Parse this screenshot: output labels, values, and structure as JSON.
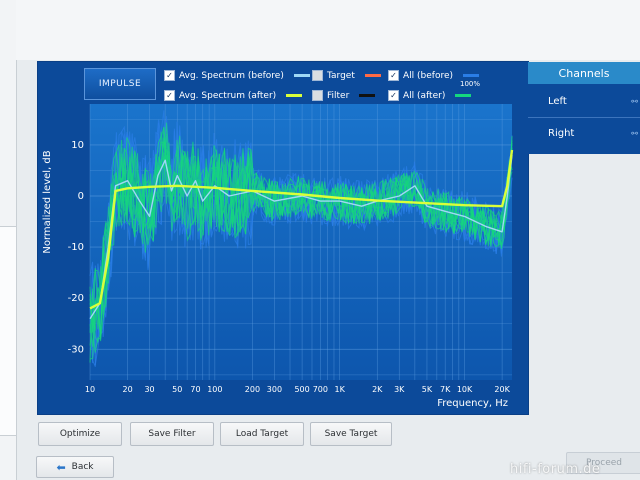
{
  "impulse_button": {
    "label": "IMPULSE"
  },
  "legend": {
    "avg_before": {
      "label": "Avg. Spectrum (before)",
      "checked": true,
      "color": "#9fd8f5"
    },
    "avg_after": {
      "label": "Avg. Spectrum (after)",
      "checked": true,
      "color": "#d9ff3a"
    },
    "target": {
      "label": "Target",
      "checked": false,
      "color": "#ff6a45"
    },
    "filter": {
      "label": "Filter",
      "checked": false,
      "color": "#111111"
    },
    "all_before": {
      "label": "All (before)",
      "checked": true,
      "color": "#2a7de6"
    },
    "all_after": {
      "label": "All (after)",
      "checked": true,
      "color": "#15d77e"
    },
    "percent": "100%"
  },
  "channels": {
    "header": "Channels",
    "items": [
      {
        "label": "Left"
      },
      {
        "label": "Right"
      }
    ]
  },
  "buttons": {
    "optimize": "Optimize",
    "save_filter": "Save Filter",
    "load_target": "Load Target",
    "save_target": "Save Target",
    "back": "Back",
    "proceed": "Proceed"
  },
  "watermark": "hifi-forum.de",
  "chart_data": {
    "type": "line",
    "xlabel": "Frequency, Hz",
    "ylabel": "Normalized level, dB",
    "x_scale": "log",
    "xlim": [
      10,
      24000
    ],
    "ylim": [
      -36,
      18
    ],
    "x_ticks": [
      {
        "v": 10,
        "label": "10"
      },
      {
        "v": 20,
        "label": "20"
      },
      {
        "v": 30,
        "label": "30"
      },
      {
        "v": 50,
        "label": "50"
      },
      {
        "v": 70,
        "label": "70"
      },
      {
        "v": 100,
        "label": "100"
      },
      {
        "v": 200,
        "label": "200"
      },
      {
        "v": 300,
        "label": "300"
      },
      {
        "v": 500,
        "label": "500"
      },
      {
        "v": 700,
        "label": "700"
      },
      {
        "v": 1000,
        "label": "1K"
      },
      {
        "v": 2000,
        "label": "2K"
      },
      {
        "v": 3000,
        "label": "3K"
      },
      {
        "v": 5000,
        "label": "5K"
      },
      {
        "v": 7000,
        "label": "7K"
      },
      {
        "v": 10000,
        "label": "10K"
      },
      {
        "v": 20000,
        "label": "20K"
      }
    ],
    "y_ticks": [
      {
        "v": 10,
        "label": "10"
      },
      {
        "v": 0,
        "label": "0"
      },
      {
        "v": -10,
        "label": "-10"
      },
      {
        "v": -20,
        "label": "-20"
      },
      {
        "v": -30,
        "label": "-30"
      }
    ],
    "grid": true,
    "series": [
      {
        "name": "Avg. Spectrum (after)",
        "color": "#d9ff3a",
        "x": [
          10,
          12,
          14,
          16,
          20,
          30,
          50,
          100,
          200,
          500,
          1000,
          2000,
          5000,
          10000,
          20000,
          22000,
          24000
        ],
        "y": [
          -22,
          -21,
          -12,
          1,
          1.5,
          1.8,
          2,
          1.6,
          1,
          0.3,
          -0.4,
          -0.9,
          -1.4,
          -1.8,
          -2,
          2,
          9
        ]
      },
      {
        "name": "Avg. Spectrum (before)",
        "color": "#9fd8f5",
        "x": [
          10,
          12,
          14,
          16,
          20,
          25,
          30,
          35,
          40,
          45,
          50,
          60,
          70,
          80,
          100,
          130,
          200,
          300,
          500,
          700,
          1000,
          1500,
          2000,
          3000,
          4000,
          5000,
          7000,
          10000,
          15000,
          20000,
          22000,
          24000
        ],
        "y": [
          -24,
          -21,
          -10,
          2,
          3,
          -1,
          -4,
          4,
          7,
          1,
          4,
          0,
          3,
          -1,
          2,
          0,
          1,
          -1,
          0,
          -1,
          -1,
          -2,
          -1,
          0,
          2,
          -2,
          -3,
          -4,
          -6,
          -7,
          0,
          8
        ]
      }
    ]
  }
}
